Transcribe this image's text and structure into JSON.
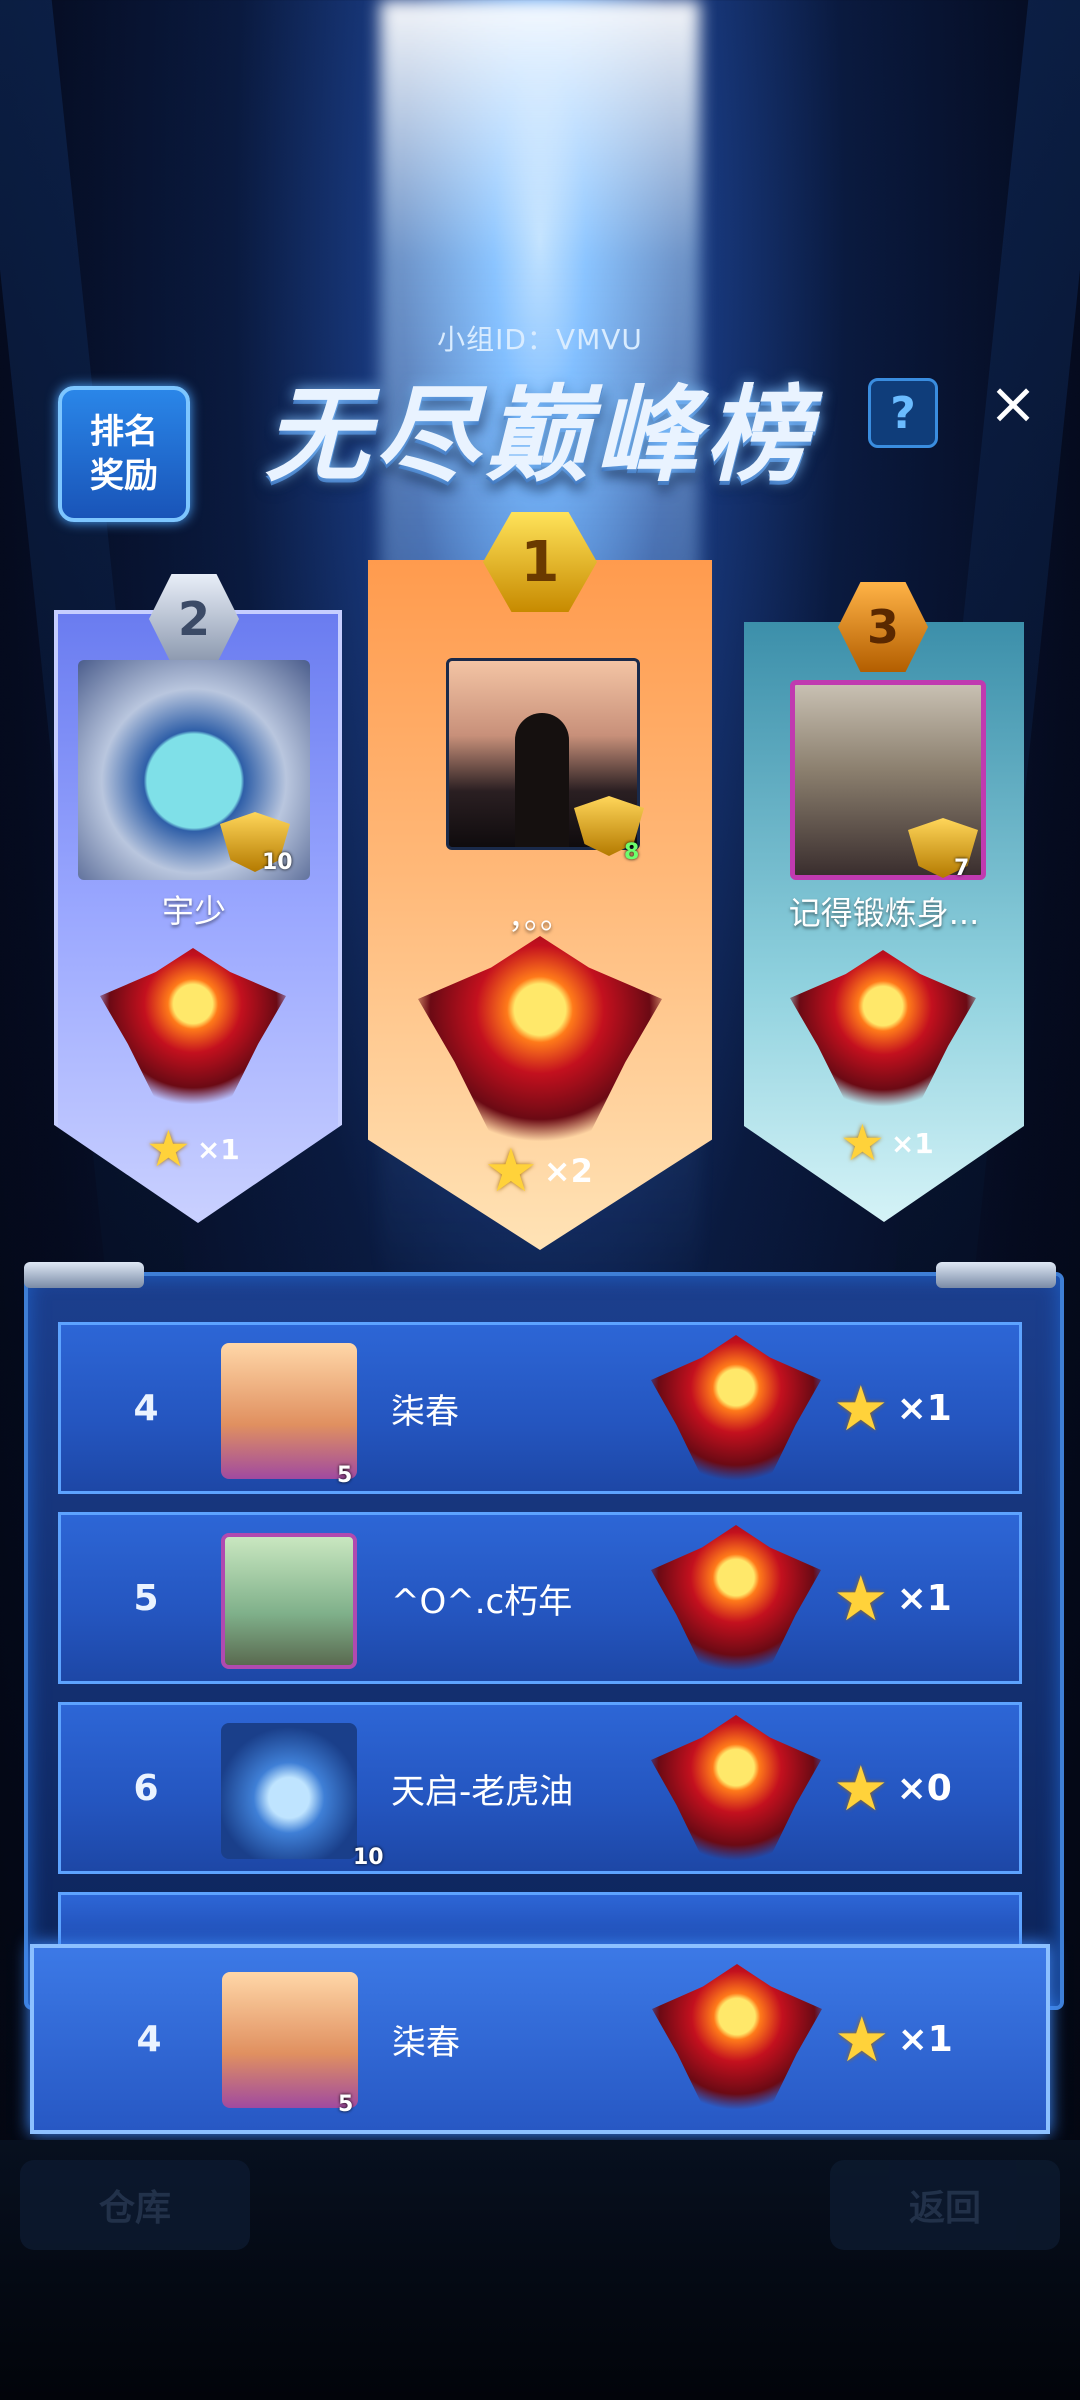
{
  "header": {
    "group_id": "小组ID：VMVU",
    "title": "无尽巅峰榜",
    "rank_reward_line1": "排名",
    "rank_reward_line2": "奖励",
    "help_label": "?",
    "close_label": "×"
  },
  "top_three": [
    {
      "rank": "2",
      "name": "宇少",
      "level": "10",
      "stars": "×1"
    },
    {
      "rank": "1",
      "name": "，。。",
      "level": "8",
      "stars": "×2"
    },
    {
      "rank": "3",
      "name": "记得锻炼身...",
      "level": "7",
      "stars": "×1"
    }
  ],
  "list": [
    {
      "rank": "4",
      "name": "柒春",
      "level": "5",
      "stars": "×1"
    },
    {
      "rank": "5",
      "name": "^O^.c朽年",
      "level": "",
      "stars": "×1"
    },
    {
      "rank": "6",
      "name": "天启-老虎油",
      "level": "10",
      "stars": "×0"
    }
  ],
  "self": {
    "rank": "4",
    "name": "柒春",
    "level": "5",
    "stars": "×1"
  },
  "bottom_buttons": {
    "left": "仓库",
    "right": "返回"
  },
  "icons": {
    "star": "star-icon",
    "emblem": "rank-emblem-icon",
    "close": "close-icon",
    "help": "help-icon"
  }
}
